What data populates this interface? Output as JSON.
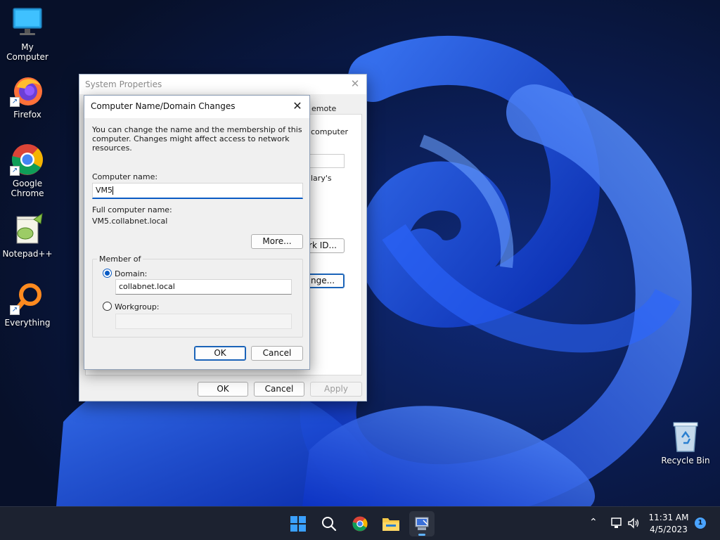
{
  "desktop": {
    "icons": [
      {
        "label": "My Computer"
      },
      {
        "label": "Firefox"
      },
      {
        "label": "Google Chrome"
      },
      {
        "label": "Notepad++"
      },
      {
        "label": "Everything"
      },
      {
        "label": "Recycle Bin"
      }
    ]
  },
  "system_properties": {
    "title": "System Properties",
    "fragments": [
      "emote",
      "computer",
      "lary's",
      "rk ID...",
      "nge..."
    ],
    "buttons": {
      "ok": "OK",
      "cancel": "Cancel",
      "apply": "Apply"
    }
  },
  "computer_name_dialog": {
    "title": "Computer Name/Domain Changes",
    "description": "You can change the name and the membership of this computer. Changes might affect access to network resources.",
    "computer_name_label": "Computer name:",
    "computer_name_value": "VM5",
    "full_name_label": "Full computer name:",
    "full_name_value": "VM5.collabnet.local",
    "more_button": "More...",
    "member_of_label": "Member of",
    "domain_label": "Domain:",
    "domain_value": "collabnet.local",
    "workgroup_label": "Workgroup:",
    "workgroup_value": "",
    "ok_button": "OK",
    "cancel_button": "Cancel"
  },
  "taskbar": {
    "time": "11:31 AM",
    "date": "4/5/2023",
    "notification_count": "1"
  },
  "colors": {
    "accent": "#0a5bc4",
    "taskbar_bg": "#1c2230"
  }
}
